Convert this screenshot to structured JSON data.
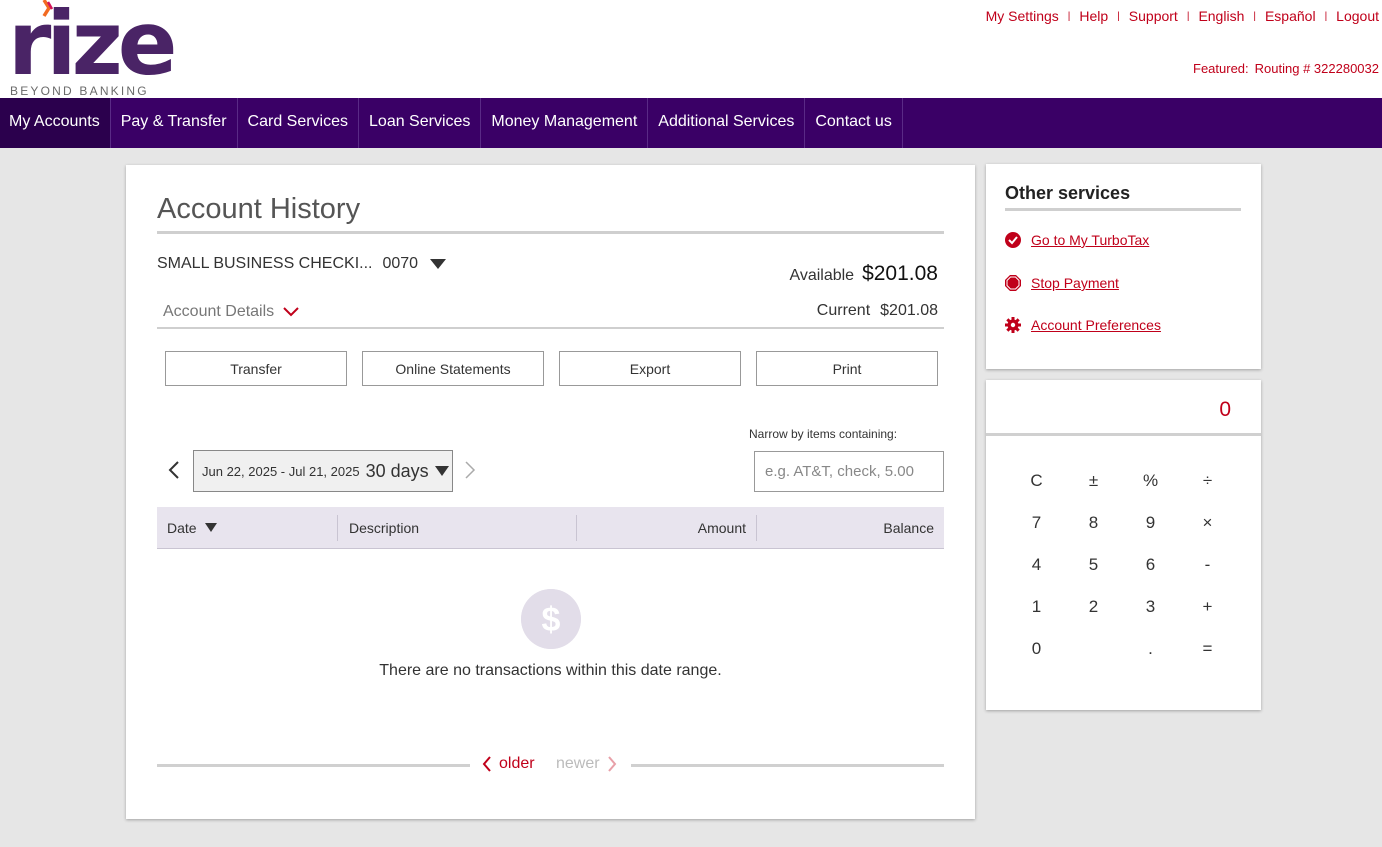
{
  "brand": {
    "logo_text": "rize",
    "tagline": "BEYOND BANKING",
    "primary_color": "#3a0066",
    "accent_color": "#c0001a"
  },
  "top_links": [
    "My Settings",
    "Help",
    "Support",
    "English",
    "Español",
    "Logout"
  ],
  "featured": {
    "label": "Featured:",
    "value": "Routing # 322280032"
  },
  "nav": {
    "items": [
      "My Accounts",
      "Pay & Transfer",
      "Card Services",
      "Loan Services",
      "Money Management",
      "Additional Services",
      "Contact us"
    ],
    "active": "My Accounts"
  },
  "main": {
    "title": "Account History",
    "account": {
      "name": "SMALL BUSINESS CHECKI...",
      "number": "0070"
    },
    "available_label": "Available",
    "available_value": "$201.08",
    "current_label": "Current",
    "current_value": "$201.08",
    "details_label": "Account Details",
    "buttons": [
      "Transfer",
      "Online Statements",
      "Export",
      "Print"
    ],
    "date_range": {
      "range": "Jun 22, 2025 - Jul 21, 2025",
      "period": "30 days"
    },
    "filter": {
      "label": "Narrow by items containing:",
      "placeholder": "e.g. AT&T, check, 5.00",
      "value": ""
    },
    "table": {
      "columns": [
        "Date",
        "Description",
        "Amount",
        "Balance"
      ],
      "rows": []
    },
    "empty_message": "There are no transactions within this date range.",
    "pager": {
      "older": "older",
      "newer": "newer"
    }
  },
  "services": {
    "title": "Other services",
    "items": [
      {
        "label": "Go to My TurboTax",
        "icon": "check-circle-icon"
      },
      {
        "label": "Stop Payment",
        "icon": "stop-icon"
      },
      {
        "label": "Account Preferences",
        "icon": "gear-icon"
      }
    ]
  },
  "calculator": {
    "display": "0",
    "keys": [
      "C",
      "±",
      "%",
      "÷",
      "7",
      "8",
      "9",
      "×",
      "4",
      "5",
      "6",
      "-",
      "1",
      "2",
      "3",
      "+",
      "0",
      "",
      ".",
      "="
    ]
  }
}
